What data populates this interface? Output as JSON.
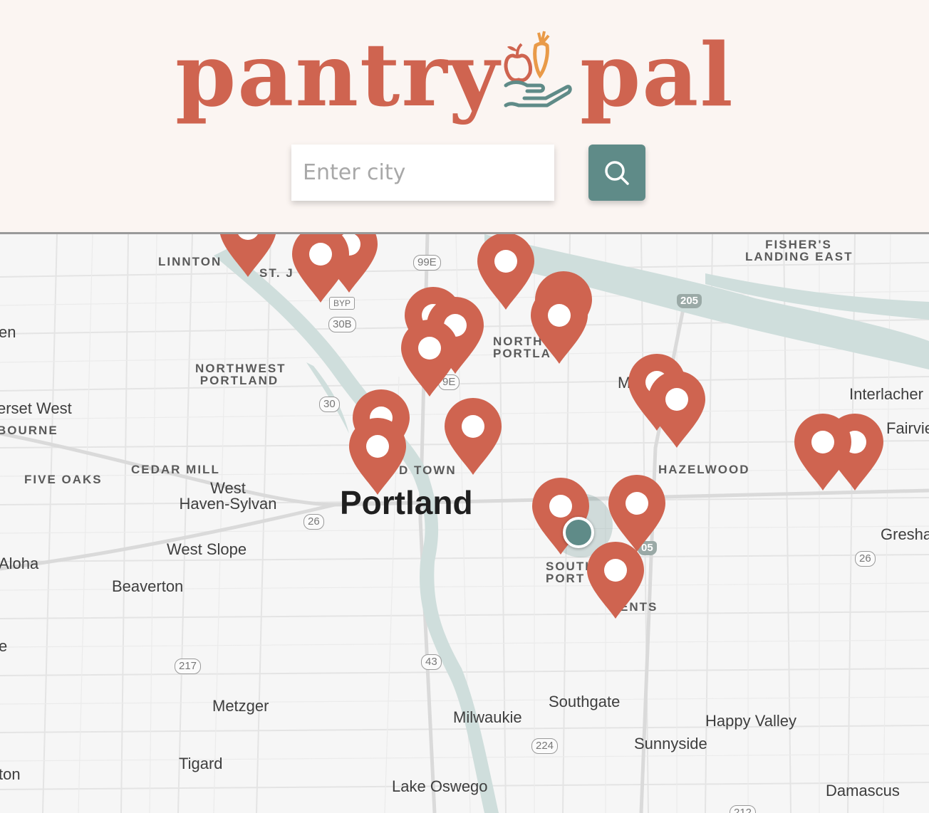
{
  "brand": {
    "name_part1": "pantry",
    "name_part2": "pal",
    "logo_icon": "produce-in-hand-icon",
    "color_primary": "#cf6450",
    "color_secondary": "#5f8b88",
    "color_accent": "#e99a48",
    "header_bg": "#fbf5f2"
  },
  "search": {
    "placeholder": "Enter city",
    "value": "",
    "button_icon": "search-icon"
  },
  "map": {
    "labels": {
      "linnton": "LINNTON",
      "st_j": "ST. J",
      "fishers1": "FISHER'S",
      "fishers2": "LANDING EAST",
      "north1": "NORTH",
      "north2": "PORTLA",
      "northwest1": "NORTHWEST",
      "northwest2": "PORTLAND",
      "erset": "erset West",
      "bourne": "BOURNE",
      "five_oaks": "FIVE OAKS",
      "cedar_mill": "CEDAR MILL",
      "west1": "West",
      "west2": "Haven-Sylvan",
      "portland": "Portland",
      "old_town": "D TOWN",
      "hazelwood": "HAZELWOOD",
      "interlachen": "Interlacher",
      "fairview": "Fairvie",
      "west_slope": "West Slope",
      "aloha": "Aloha",
      "beaverton": "Beaverton",
      "south1": "SOUTH",
      "south2": "PORT",
      "ents": "ENTS",
      "gresham": "Gresha",
      "metzger": "Metzger",
      "milwaukie": "Milwaukie",
      "southgate": "Southgate",
      "happy_valley": "Happy Valley",
      "sunnyside": "Sunnyside",
      "tigard": "Tigard",
      "lake_oswego": "Lake Oswego",
      "damascus": "Damascus",
      "ton": "ton",
      "en": "en",
      "e": "e",
      "m": "M"
    },
    "shields": {
      "r99e": "99E",
      "r30b": "30B",
      "byp": "BYP",
      "r205a": "205",
      "r30": "30",
      "r26a": "26",
      "r26b": "26",
      "r217": "217",
      "r43": "43",
      "r224": "224",
      "r205b": "05",
      "r99e_b": "9E",
      "r212": "212"
    },
    "pin_count": 22,
    "pin_icon": "map-pin-icon",
    "user_location_icon": "user-location-icon"
  }
}
